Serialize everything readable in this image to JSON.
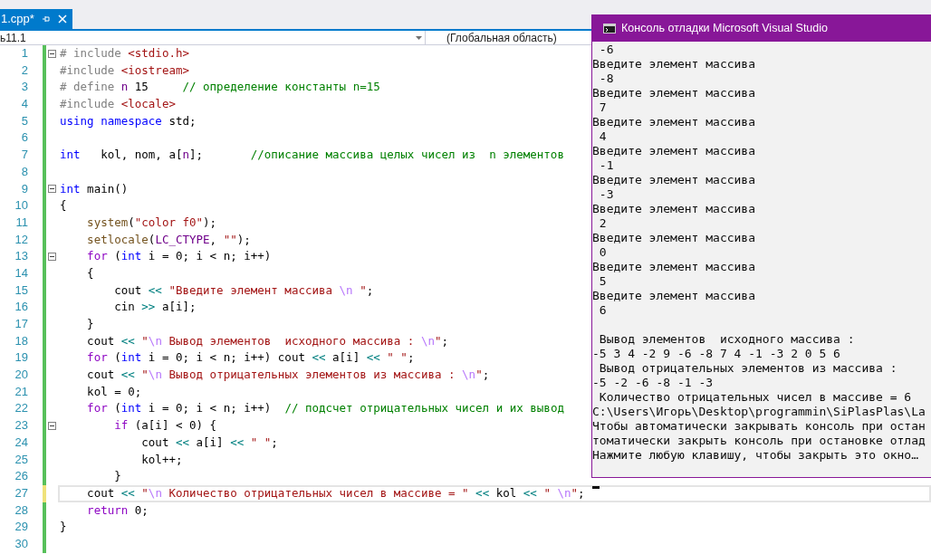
{
  "tab": {
    "label": "1.cpp*",
    "selected": true
  },
  "navigation": {
    "project": "ь11.1",
    "scope": "(Глобальная область)"
  },
  "editor": {
    "lines": [
      {
        "number": "1",
        "fold": true,
        "saved": true,
        "current": false,
        "tokens": [
          {
            "kind": "preproc",
            "text": "# include "
          },
          {
            "kind": "string",
            "text": "<stdio.h>"
          }
        ]
      },
      {
        "number": "2",
        "fold": false,
        "saved": true,
        "current": false,
        "tokens": [
          {
            "kind": "preproc",
            "text": "#include "
          },
          {
            "kind": "string",
            "text": "<iostream>"
          }
        ]
      },
      {
        "number": "3",
        "fold": false,
        "saved": true,
        "current": false,
        "tokens": [
          {
            "kind": "preproc",
            "text": "# define "
          },
          {
            "kind": "macro",
            "text": "n"
          },
          {
            "kind": "plain",
            "text": " 15     "
          },
          {
            "kind": "comment",
            "text": "// определение константы n=15"
          }
        ]
      },
      {
        "number": "4",
        "fold": false,
        "saved": true,
        "current": false,
        "tokens": [
          {
            "kind": "preproc",
            "text": "#include "
          },
          {
            "kind": "string",
            "text": "<locale>"
          }
        ]
      },
      {
        "number": "5",
        "fold": false,
        "saved": true,
        "current": false,
        "tokens": [
          {
            "kind": "keyword",
            "text": "using namespace"
          },
          {
            "kind": "plain",
            "text": " std;"
          }
        ]
      },
      {
        "number": "6",
        "fold": false,
        "saved": true,
        "current": false
      },
      {
        "number": "7",
        "fold": false,
        "saved": true,
        "current": false,
        "tokens": [
          {
            "kind": "keyword",
            "text": "int"
          },
          {
            "kind": "plain",
            "text": "   kol, nom, a["
          },
          {
            "kind": "macro",
            "text": "n"
          },
          {
            "kind": "plain",
            "text": "];       "
          },
          {
            "kind": "comment",
            "text": "//описание массива целых чисел из  n элементов"
          }
        ]
      },
      {
        "number": "8",
        "fold": false,
        "saved": true,
        "current": false
      },
      {
        "number": "9",
        "fold": true,
        "saved": true,
        "current": false,
        "tokens": [
          {
            "kind": "keyword",
            "text": "int"
          },
          {
            "kind": "plain",
            "text": " main()"
          }
        ]
      },
      {
        "number": "10",
        "fold": false,
        "saved": true,
        "current": false,
        "tokens": [
          {
            "kind": "plain",
            "text": "{"
          }
        ]
      },
      {
        "number": "11",
        "fold": false,
        "saved": true,
        "current": false,
        "tokens": [
          {
            "kind": "func",
            "text": "    system"
          },
          {
            "kind": "plain",
            "text": "("
          },
          {
            "kind": "string",
            "text": "\"color f0\""
          },
          {
            "kind": "plain",
            "text": ");"
          }
        ]
      },
      {
        "number": "12",
        "fold": false,
        "saved": true,
        "current": false,
        "tokens": [
          {
            "kind": "func",
            "text": "    setlocale"
          },
          {
            "kind": "plain",
            "text": "("
          },
          {
            "kind": "macro",
            "text": "LC_CTYPE"
          },
          {
            "kind": "plain",
            "text": ", "
          },
          {
            "kind": "string",
            "text": "\"\""
          },
          {
            "kind": "plain",
            "text": ");"
          }
        ]
      },
      {
        "number": "13",
        "fold": true,
        "saved": true,
        "current": false,
        "tokens": [
          {
            "kind": "control",
            "text": "    for"
          },
          {
            "kind": "plain",
            "text": " ("
          },
          {
            "kind": "keyword",
            "text": "int"
          },
          {
            "kind": "plain",
            "text": " i = 0; i < n; i++)"
          }
        ]
      },
      {
        "number": "14",
        "fold": false,
        "saved": true,
        "current": false,
        "tokens": [
          {
            "kind": "plain",
            "text": "    {"
          }
        ]
      },
      {
        "number": "15",
        "fold": false,
        "saved": true,
        "current": false,
        "tokens": [
          {
            "kind": "plain",
            "text": "        cout "
          },
          {
            "kind": "operator",
            "text": "<<"
          },
          {
            "kind": "string",
            "text": " \"Введите элемент массива "
          },
          {
            "kind": "escape",
            "text": "\\n"
          },
          {
            "kind": "string",
            "text": " \""
          },
          {
            "kind": "plain",
            "text": ";"
          }
        ]
      },
      {
        "number": "16",
        "fold": false,
        "saved": true,
        "current": false,
        "tokens": [
          {
            "kind": "plain",
            "text": "        cin "
          },
          {
            "kind": "operator",
            "text": ">>"
          },
          {
            "kind": "plain",
            "text": " a[i];"
          }
        ]
      },
      {
        "number": "17",
        "fold": false,
        "saved": true,
        "current": false,
        "tokens": [
          {
            "kind": "plain",
            "text": "    }"
          }
        ]
      },
      {
        "number": "18",
        "fold": false,
        "saved": true,
        "current": false,
        "tokens": [
          {
            "kind": "plain",
            "text": "    cout "
          },
          {
            "kind": "operator",
            "text": "<<"
          },
          {
            "kind": "string",
            "text": " \""
          },
          {
            "kind": "escape",
            "text": "\\n"
          },
          {
            "kind": "string",
            "text": " Вывод элементов  исходного массива : "
          },
          {
            "kind": "escape",
            "text": "\\n"
          },
          {
            "kind": "string",
            "text": "\""
          },
          {
            "kind": "plain",
            "text": ";"
          }
        ]
      },
      {
        "number": "19",
        "fold": false,
        "saved": true,
        "current": false,
        "tokens": [
          {
            "kind": "control",
            "text": "    for"
          },
          {
            "kind": "plain",
            "text": " ("
          },
          {
            "kind": "keyword",
            "text": "int"
          },
          {
            "kind": "plain",
            "text": " i = 0; i < n; i++) cout "
          },
          {
            "kind": "operator",
            "text": "<<"
          },
          {
            "kind": "plain",
            "text": " a[i] "
          },
          {
            "kind": "operator",
            "text": "<<"
          },
          {
            "kind": "string",
            "text": " \" \""
          },
          {
            "kind": "plain",
            "text": ";"
          }
        ]
      },
      {
        "number": "20",
        "fold": false,
        "saved": true,
        "current": false,
        "tokens": [
          {
            "kind": "plain",
            "text": "    cout "
          },
          {
            "kind": "operator",
            "text": "<<"
          },
          {
            "kind": "string",
            "text": " \""
          },
          {
            "kind": "escape",
            "text": "\\n"
          },
          {
            "kind": "string",
            "text": " Вывод отрицательных элементов из массива : "
          },
          {
            "kind": "escape",
            "text": "\\n"
          },
          {
            "kind": "string",
            "text": "\""
          },
          {
            "kind": "plain",
            "text": ";"
          }
        ]
      },
      {
        "number": "21",
        "fold": false,
        "saved": true,
        "current": false,
        "tokens": [
          {
            "kind": "plain",
            "text": "    kol = 0;"
          }
        ]
      },
      {
        "number": "22",
        "fold": false,
        "saved": true,
        "current": false,
        "tokens": [
          {
            "kind": "control",
            "text": "    for"
          },
          {
            "kind": "plain",
            "text": " ("
          },
          {
            "kind": "keyword",
            "text": "int"
          },
          {
            "kind": "plain",
            "text": " i = 0; i < n; i++)"
          },
          {
            "kind": "comment",
            "text": "  // подсчет отрицательных чисел и их вывод"
          }
        ]
      },
      {
        "number": "23",
        "fold": true,
        "saved": true,
        "current": false,
        "tokens": [
          {
            "kind": "control",
            "text": "        if"
          },
          {
            "kind": "plain",
            "text": " (a[i] < 0) {"
          }
        ]
      },
      {
        "number": "24",
        "fold": false,
        "saved": true,
        "current": false,
        "tokens": [
          {
            "kind": "plain",
            "text": "            cout "
          },
          {
            "kind": "operator",
            "text": "<<"
          },
          {
            "kind": "plain",
            "text": " a[i] "
          },
          {
            "kind": "operator",
            "text": "<<"
          },
          {
            "kind": "string",
            "text": " \" \""
          },
          {
            "kind": "plain",
            "text": ";"
          }
        ]
      },
      {
        "number": "25",
        "fold": false,
        "saved": true,
        "current": false,
        "tokens": [
          {
            "kind": "plain",
            "text": "            kol++;"
          }
        ]
      },
      {
        "number": "26",
        "fold": false,
        "saved": true,
        "current": false,
        "tokens": [
          {
            "kind": "plain",
            "text": "        }"
          }
        ]
      },
      {
        "number": "27",
        "fold": false,
        "saved": false,
        "current": true,
        "tokens": [
          {
            "kind": "plain",
            "text": "    cout "
          },
          {
            "kind": "operator",
            "text": "<<"
          },
          {
            "kind": "string",
            "text": " \""
          },
          {
            "kind": "escape",
            "text": "\\n"
          },
          {
            "kind": "string",
            "text": " Количество отрицательных чисел в массиве = \""
          },
          {
            "kind": "operator",
            "text": " <<"
          },
          {
            "kind": "plain",
            "text": " kol "
          },
          {
            "kind": "operator",
            "text": "<<"
          },
          {
            "kind": "string",
            "text": " \" "
          },
          {
            "kind": "escape",
            "text": "\\n"
          },
          {
            "kind": "string",
            "text": "\""
          },
          {
            "kind": "plain",
            "text": ";"
          }
        ]
      },
      {
        "number": "28",
        "fold": false,
        "saved": true,
        "current": false,
        "tokens": [
          {
            "kind": "control",
            "text": "    return"
          },
          {
            "kind": "plain",
            "text": " 0;"
          }
        ]
      },
      {
        "number": "29",
        "fold": false,
        "saved": true,
        "current": false,
        "tokens": [
          {
            "kind": "plain",
            "text": "}"
          }
        ]
      },
      {
        "number": "30",
        "fold": false,
        "saved": true,
        "current": false
      }
    ]
  },
  "console": {
    "title": "Консоль отладки Microsoft Visual Studio",
    "cursor": true,
    "lines": [
      {
        "kind": "text",
        "text": " -6"
      },
      {
        "kind": "text",
        "text": "Введите элемент массива"
      },
      {
        "kind": "text",
        "text": " -8"
      },
      {
        "kind": "text",
        "text": "Введите элемент массива"
      },
      {
        "kind": "text",
        "text": " 7"
      },
      {
        "kind": "text",
        "text": "Введите элемент массива"
      },
      {
        "kind": "text",
        "text": " 4"
      },
      {
        "kind": "text",
        "text": "Введите элемент массива"
      },
      {
        "kind": "text",
        "text": " -1"
      },
      {
        "kind": "text",
        "text": "Введите элемент массива"
      },
      {
        "kind": "text",
        "text": " -3"
      },
      {
        "kind": "text",
        "text": "Введите элемент массива"
      },
      {
        "kind": "text",
        "text": " 2"
      },
      {
        "kind": "text",
        "text": "Введите элемент массива"
      },
      {
        "kind": "text",
        "text": " 0"
      },
      {
        "kind": "text",
        "text": "Введите элемент массива"
      },
      {
        "kind": "text",
        "text": " 5"
      },
      {
        "kind": "text",
        "text": "Введите элемент массива"
      },
      {
        "kind": "text",
        "text": " 6"
      },
      {
        "kind": "blank"
      },
      {
        "kind": "text",
        "text": " Вывод элементов  исходного массива :"
      },
      {
        "kind": "text",
        "text": "-5 3 4 -2 9 -6 -8 7 4 -1 -3 2 0 5 6"
      },
      {
        "kind": "text",
        "text": " Вывод отрицательных элементов из массива :"
      },
      {
        "kind": "text",
        "text": "-5 -2 -6 -8 -1 -3"
      },
      {
        "kind": "text",
        "text": " Количество отрицательных чисел в массиве = 6"
      },
      {
        "kind": "text",
        "text": "C:\\Users\\Игорь\\Desktop\\programmin\\SiPlasPlas\\La"
      },
      {
        "kind": "text",
        "text": "Чтобы автоматически закрывать консоль при остан"
      },
      {
        "kind": "text",
        "text": "томатически закрыть консоль при остановке отлад"
      },
      {
        "kind": "text",
        "text": "Нажмите любую клавишу, чтобы закрыть это окно…"
      },
      {
        "kind": "blank"
      }
    ]
  }
}
